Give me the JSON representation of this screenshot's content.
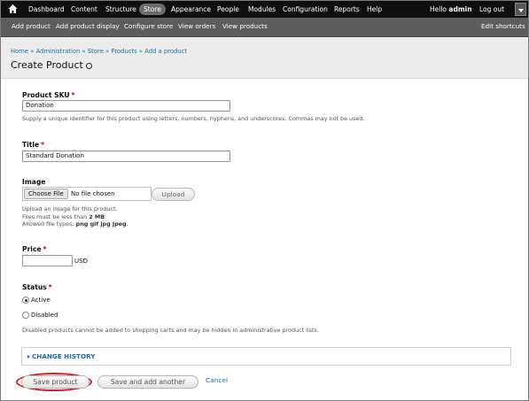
{
  "toolbar": {
    "items": [
      "Dashboard",
      "Content",
      "Structure",
      "Store",
      "Appearance",
      "People",
      "Modules",
      "Configuration",
      "Reports",
      "Help"
    ],
    "active_item": "Store",
    "greeting": "Hello",
    "username": "admin",
    "logout": "Log out"
  },
  "shortcuts": {
    "items": [
      "Add product",
      "Add product display",
      "Configure store",
      "View orders",
      "View products"
    ],
    "edit": "Edit shortcuts"
  },
  "breadcrumb": [
    "Home",
    "Administration",
    "Store",
    "Products",
    "Add a product"
  ],
  "breadcrumb_separator": "»",
  "page_title": "Create Product",
  "form": {
    "sku": {
      "label": "Product SKU",
      "required": "*",
      "value": "Donation",
      "description": "Supply a unique identifier for this product using letters, numbers, hyphens, and underscores. Commas may not be used."
    },
    "title": {
      "label": "Title",
      "required": "*",
      "value": "Standard Donation"
    },
    "image": {
      "label": "Image",
      "choose_button": "Choose File",
      "no_file": "No file chosen",
      "upload_button": "Upload",
      "desc_line1": "Upload an image for this product.",
      "desc_line2_prefix": "Files must be less than",
      "max_size": "2 MB",
      "desc_line3_prefix": "Allowed file types:",
      "allowed_types": "png gif jpg jpeg"
    },
    "price": {
      "label": "Price",
      "required": "*",
      "value": "",
      "currency": "USD"
    },
    "status": {
      "label": "Status",
      "required": "*",
      "options": [
        "Active",
        "Disabled"
      ],
      "selected": "Active",
      "description": "Disabled products cannot be added to shopping carts and may be hidden in administrative product lists."
    },
    "change_history": "CHANGE HISTORY"
  },
  "actions": {
    "save": "Save product",
    "save_another": "Save and add another",
    "cancel": "Cancel"
  },
  "colors": {
    "link": "#1d6fa5",
    "required": "#cc0000",
    "highlight_ring": "#d11f25"
  }
}
